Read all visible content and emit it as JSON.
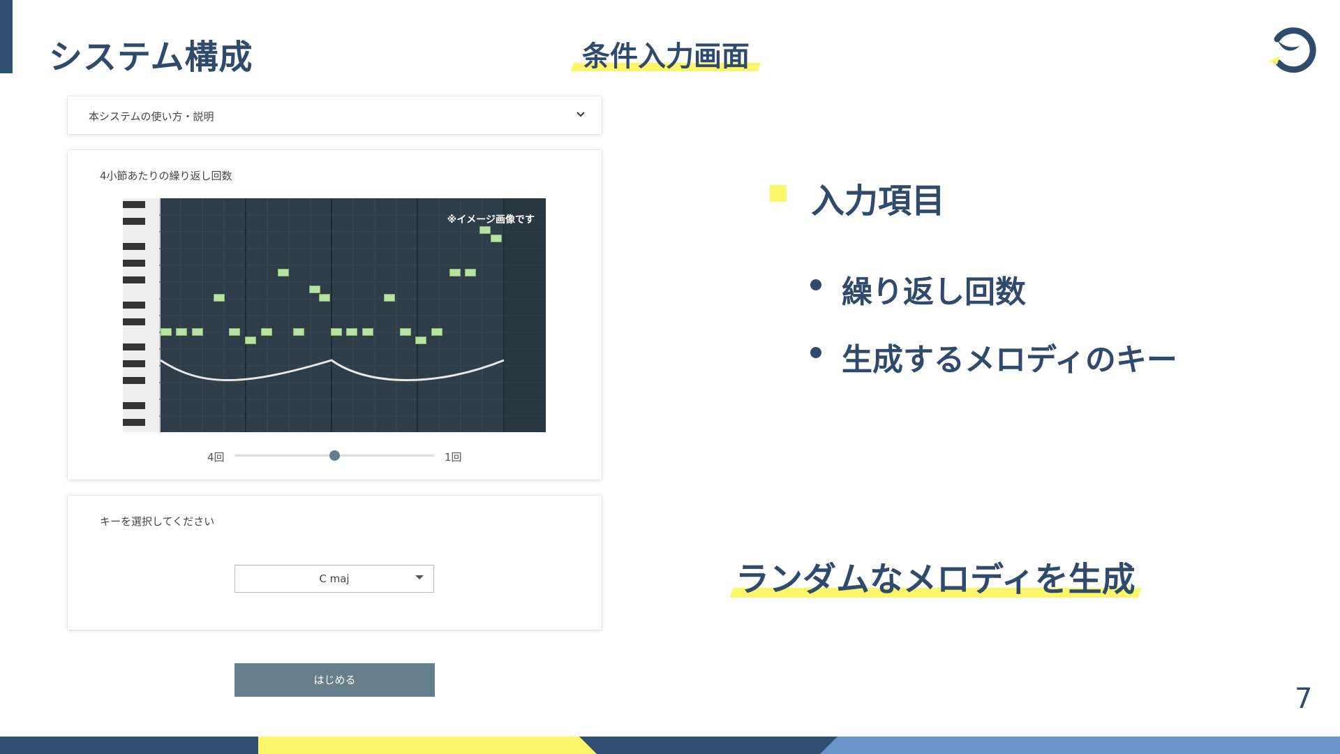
{
  "slide": {
    "title": "システム構成",
    "subtitle": "条件入力画面",
    "page_number": "7"
  },
  "app": {
    "accordion_label": "本システムの使い方・説明",
    "repeat_card": {
      "label": "4小節あたりの繰り返し回数",
      "image_caption": "※イメージ画像です",
      "slider_min_label": "4回",
      "slider_max_label": "1回",
      "slider_value_fraction": 0.5
    },
    "key_card": {
      "label": "キーを選択してください",
      "selected_key": "C maj"
    },
    "start_button": "はじめる"
  },
  "right": {
    "heading": "入力項目",
    "items": [
      "繰り返し回数",
      "生成するメロディのキー"
    ],
    "bottom_note": "ランダムなメロディを生成"
  },
  "colors": {
    "navy": "#2f4a6b",
    "accent_yellow": "#fbf66a",
    "light_blue": "#6a95c9",
    "button_gray": "#667f8d"
  }
}
